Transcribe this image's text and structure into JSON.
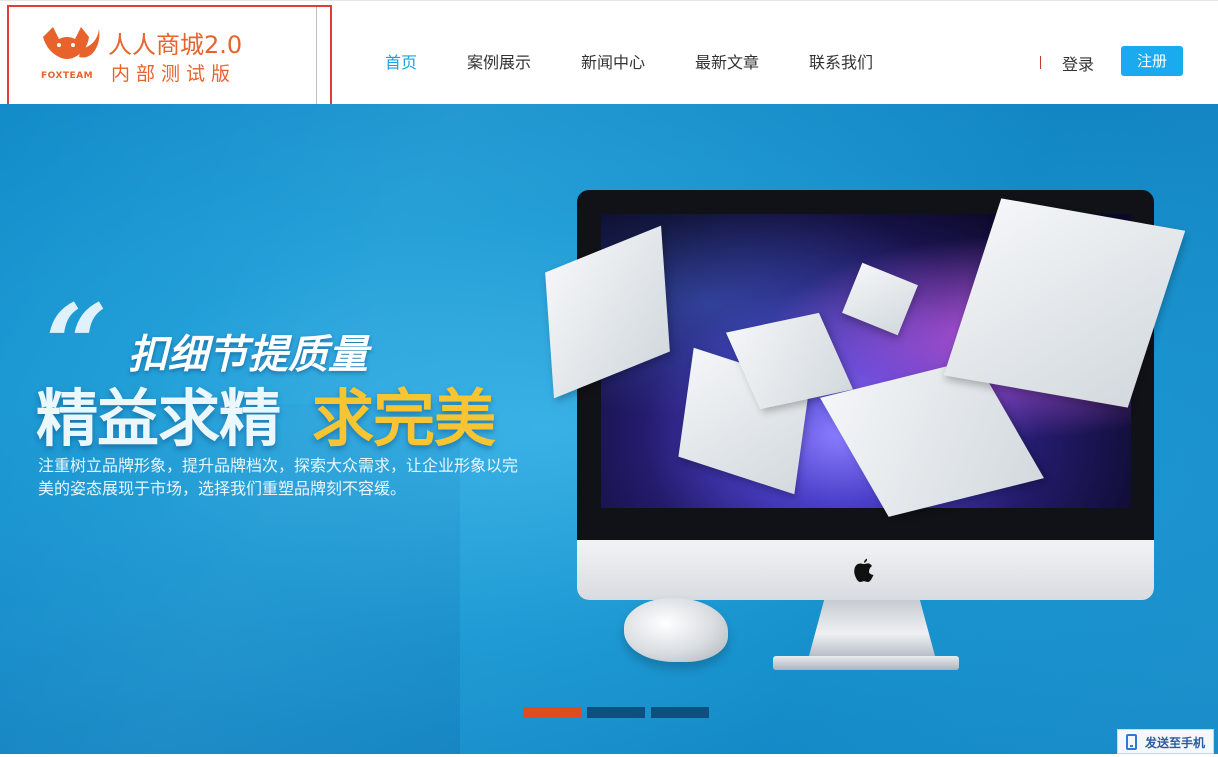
{
  "logo": {
    "brand_text": "FOXTEAM",
    "title": "人人商城2.0",
    "subtitle": "内部测试版",
    "icon": "fox-logo-icon"
  },
  "nav": {
    "items": [
      {
        "label": "首页",
        "active": true
      },
      {
        "label": "案例展示",
        "active": false
      },
      {
        "label": "新闻中心",
        "active": false
      },
      {
        "label": "最新文章",
        "active": false
      },
      {
        "label": "联系我们",
        "active": false
      }
    ]
  },
  "account": {
    "login_label": "登录",
    "register_label": "注册"
  },
  "banner": {
    "quote_mark": "“",
    "slogan_line1": "扣细节提质量",
    "slogan_line2_white": "精益求精",
    "slogan_line2_yellow": "求完美",
    "description": "注重树立品牌形象，提升品牌档次，探索大众需求，让企业形象以完美的姿态展现于市场，选择我们重塑品牌刻不容缓。",
    "slides": [
      {
        "active": true
      },
      {
        "active": false
      },
      {
        "active": false
      }
    ],
    "apple_icon": "apple-logo-icon"
  },
  "send_to_phone": {
    "label": "发送至手机",
    "icon": "phone-icon"
  },
  "colors": {
    "brand_orange": "#e8632c",
    "nav_active": "#1ba1e2",
    "register_bg": "#19aaf0",
    "banner_blue": "#1a9bd6",
    "slogan_yellow": "#f7c531",
    "dot_active": "#e04b1f",
    "dot_inactive": "#0f4f80",
    "logo_highlight_border": "#e23b3b"
  }
}
